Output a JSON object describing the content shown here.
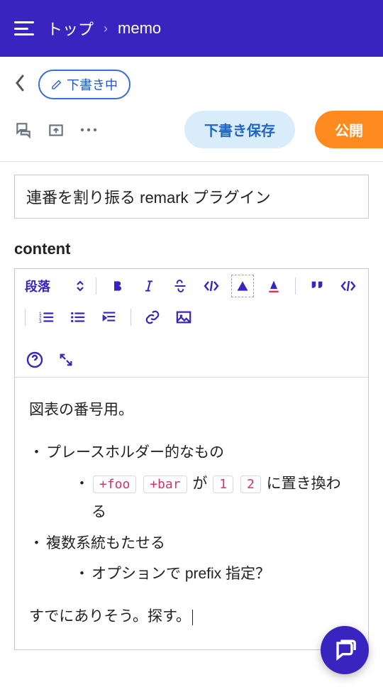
{
  "header": {
    "breadcrumb_root": "トップ",
    "breadcrumb_current": "memo"
  },
  "actions": {
    "draft_chip": "下書き中",
    "save_draft": "下書き保存",
    "publish": "公開"
  },
  "title": {
    "value": "連番を割り振る remark プラグイン"
  },
  "section": {
    "label": "content"
  },
  "toolbar": {
    "block_select": "段落"
  },
  "body": {
    "para1": "図表の番号用。",
    "li1": "プレースホルダー的なもの",
    "li1a_pre": "",
    "code1": "+foo",
    "code2": "+bar",
    "li1a_mid": " が ",
    "code3": "1",
    "code4": "2",
    "li1a_post": " に置き換わる",
    "li2": "複数系統もたせる",
    "li2a": "オプションで prefix 指定？",
    "para2": "すでにありそう。探す。"
  }
}
